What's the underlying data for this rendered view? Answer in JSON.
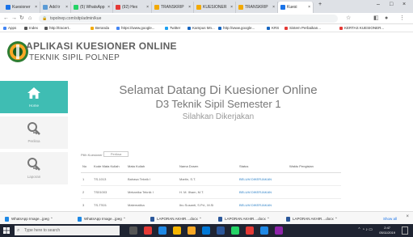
{
  "browser": {
    "tabs": [
      {
        "label": "Kuesioner",
        "color": "#1a73e8"
      },
      {
        "label": "Add tr",
        "color": "#5b9bd5"
      },
      {
        "label": "(5) WhatsApp",
        "color": "#25d366"
      },
      {
        "label": "(92) Hex",
        "color": "#e53935"
      },
      {
        "label": "TRANSKRIP",
        "color": "#f2a900"
      },
      {
        "label": "KUESIONER",
        "color": "#f2a900"
      },
      {
        "label": "TRANSKRIP",
        "color": "#f2a900"
      },
      {
        "label": "Kuesi",
        "color": "#1a73e8"
      }
    ],
    "url": "tspolnep.com/sitp/admin/kue",
    "bookmarks": [
      "Apps",
      "Index",
      "http://tracert..",
      "Beranda",
      "https://www.google...",
      "Twitter",
      "Kampus Mn...",
      "http://www.google...",
      "KRS",
      "Sistem Perbaikan...",
      "KERTAS KUESIONER..."
    ]
  },
  "app": {
    "title": "APLIKASI KUESIONER ONLINE",
    "subtitle": "TEKNIK SIPIL POLNEP",
    "sidebar": [
      {
        "label": "Home",
        "icon": "home-icon"
      },
      {
        "label": "Periksa",
        "icon": "search-icon"
      },
      {
        "label": "Laporan",
        "icon": "search-icon"
      }
    ],
    "welcome": {
      "line1": "Selamat Datang Di Kuesioner Online",
      "line2": "D3 Teknik Sipil Semester 1",
      "line3": "Silahkan Dikerjakan"
    },
    "table_label": "Pilih Kuesioner",
    "table_button": "Periksa",
    "table": {
      "headers": [
        "No",
        "Kode Mata Kuliah",
        "Mata Kuliah",
        "Nama Dosen",
        "Status",
        "Waktu Pengisian"
      ],
      "rows": [
        [
          "1",
          "TS-1013",
          "Bahasa Teknik I",
          "Martin, S.T.",
          "BELUM DIKERJAKAN",
          ""
        ],
        [
          "2",
          "TS01003",
          "Mekanika Teknik I",
          "H. M. Ilham, M.T.",
          "BELUM DIKERJAKAN",
          ""
        ],
        [
          "3",
          "TS-TS01",
          "Matematika",
          "Ibu Susanti, S.Pd., M.Si",
          "BELUM DIKERJAKAN",
          ""
        ]
      ]
    }
  },
  "downloads": {
    "items": [
      "WhatsApp Image...jpeg",
      "WhatsApp Image...jpeg",
      "LAPORAN AKHIR....docx",
      "LAPORAN AKHIR....docx",
      "LAPORAN AKHIR....docx"
    ],
    "show_all": "Show all"
  },
  "taskbar": {
    "search_placeholder": "Type here to search",
    "time": "2:47",
    "date": "05/11/2019"
  },
  "colors": {
    "accent": "#3fbdb3",
    "taskbar": "#1f2432"
  }
}
